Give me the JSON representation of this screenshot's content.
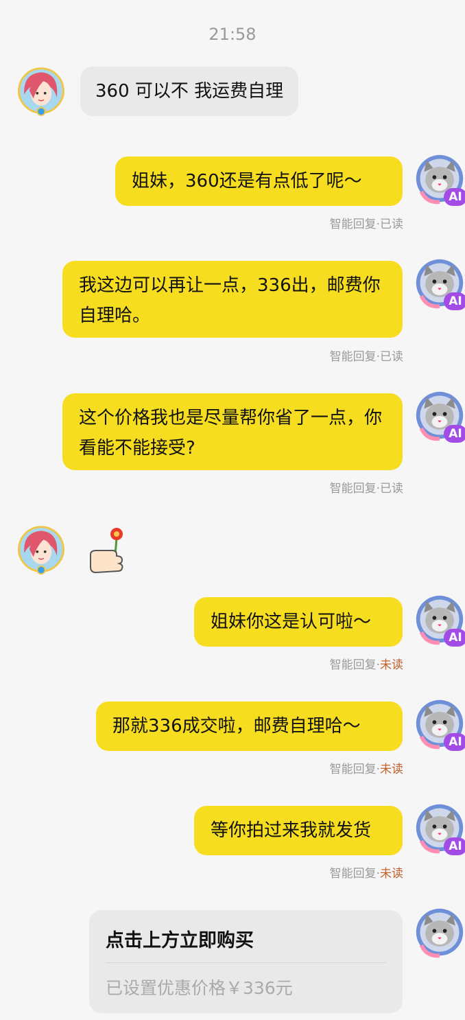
{
  "time": "21:58",
  "messages": [
    {
      "text": "360 可以不  我运费自理"
    },
    {
      "text": "姐妹，360还是有点低了呢～",
      "status_label": "智能回复",
      "status_state": "已读"
    },
    {
      "text": "我这边可以再让一点，336出，邮费你自理哈。",
      "status_label": "智能回复",
      "status_state": "已读"
    },
    {
      "text": "这个价格我也是尽量帮你省了一点，你看能不能接受?",
      "status_label": "智能回复",
      "status_state": "已读"
    },
    {
      "sticker": "thumb-flower-icon"
    },
    {
      "text": "姐妹你这是认可啦～",
      "status_label": "智能回复",
      "status_state": "未读"
    },
    {
      "text": "那就336成交啦，邮费自理哈～",
      "status_label": "智能回复",
      "status_state": "未读"
    },
    {
      "text": "等你拍过来我就发货",
      "status_label": "智能回复",
      "status_state": "未读"
    }
  ],
  "card": {
    "title": "点击上方立即购买",
    "subtitle": "已设置优惠价格￥336元"
  },
  "ai_badge": "AI",
  "colors": {
    "bubble_right": "#f6dd1f",
    "bubble_left": "#e9e9e9",
    "unread": "#c0622d",
    "ai_badge": "#a24be6"
  }
}
